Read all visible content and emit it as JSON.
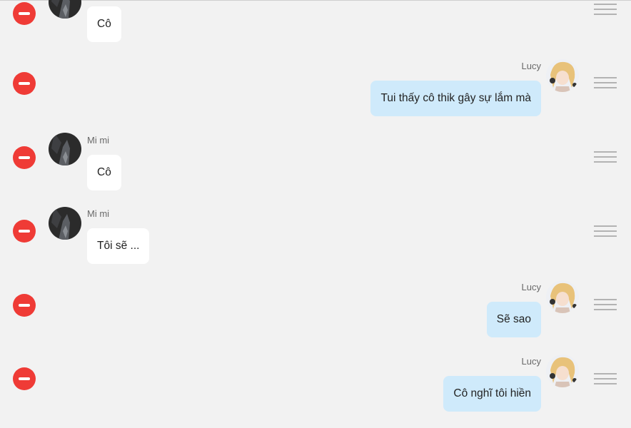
{
  "messages": [
    {
      "side": "left",
      "sender": "",
      "text": "Cô",
      "avatar": "mimi-avatar"
    },
    {
      "side": "right",
      "sender": "Lucy",
      "text": "Tui thấy cô thik gây sự lắm mà",
      "avatar": "lucy-avatar"
    },
    {
      "side": "left",
      "sender": "Mi mi",
      "text": "Cô",
      "avatar": "mimi-avatar"
    },
    {
      "side": "left",
      "sender": "Mi mi",
      "text": "Tôi sẽ ...",
      "avatar": "mimi-avatar"
    },
    {
      "side": "right",
      "sender": "Lucy",
      "text": "Sẽ sao",
      "avatar": "lucy-avatar"
    },
    {
      "side": "right",
      "sender": "Lucy",
      "text": "Cô nghĩ tôi hiền",
      "avatar": "lucy-avatar"
    }
  ],
  "icons": {
    "delete": "minus-circle-icon",
    "reorder": "drag-handle-icon"
  },
  "colors": {
    "delete_button": "#ef3b36",
    "right_bubble": "#cfeafb",
    "left_bubble": "#ffffff",
    "background": "#f2f2f2"
  }
}
